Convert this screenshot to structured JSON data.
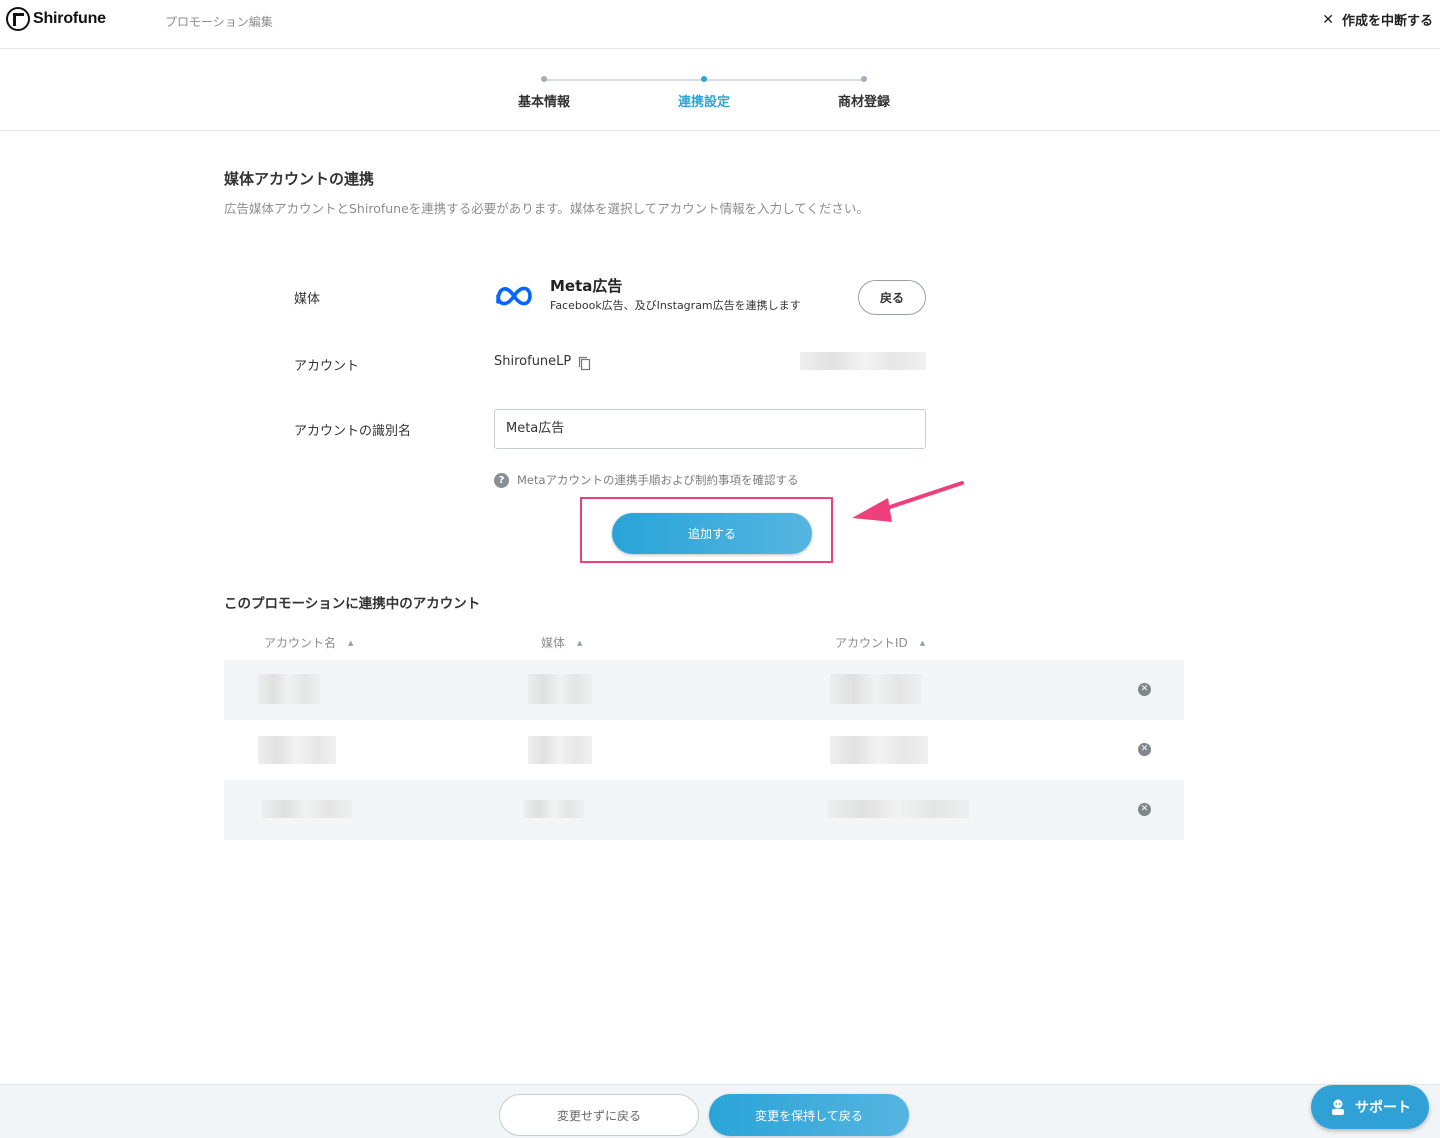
{
  "header": {
    "brand": "Shirofune",
    "page_label": "プロモーション編集",
    "abort_label": "作成を中断する"
  },
  "stepper": {
    "steps": [
      "基本情報",
      "連携設定",
      "商材登録"
    ],
    "active_index": 1
  },
  "section": {
    "title": "媒体アカウントの連携",
    "description": "広告媒体アカウントとShirofuneを連携する必要があります。媒体を選択してアカウント情報を入力してください。"
  },
  "form": {
    "media_label": "媒体",
    "media_name": "Meta広告",
    "media_sub": "Facebook広告、及びInstagram広告を連携します",
    "back_label": "戻る",
    "account_label": "アカウント",
    "account_name": "ShirofuneLP",
    "alias_label": "アカウントの識別名",
    "alias_value": "Meta広告",
    "help_text": "Metaアカウントの連携手順および制約事項を確認する",
    "add_label": "追加する"
  },
  "linked": {
    "title": "このプロモーションに連携中のアカウント",
    "columns": [
      "アカウント名",
      "媒体",
      "アカウントID"
    ]
  },
  "footer": {
    "cancel_label": "変更せずに戻る",
    "save_label": "変更を保持して戻る"
  },
  "support_label": "サポート",
  "colors": {
    "accent": "#2fa5d4",
    "highlight": "#f0407b",
    "meta_blue": "#0866ff"
  }
}
